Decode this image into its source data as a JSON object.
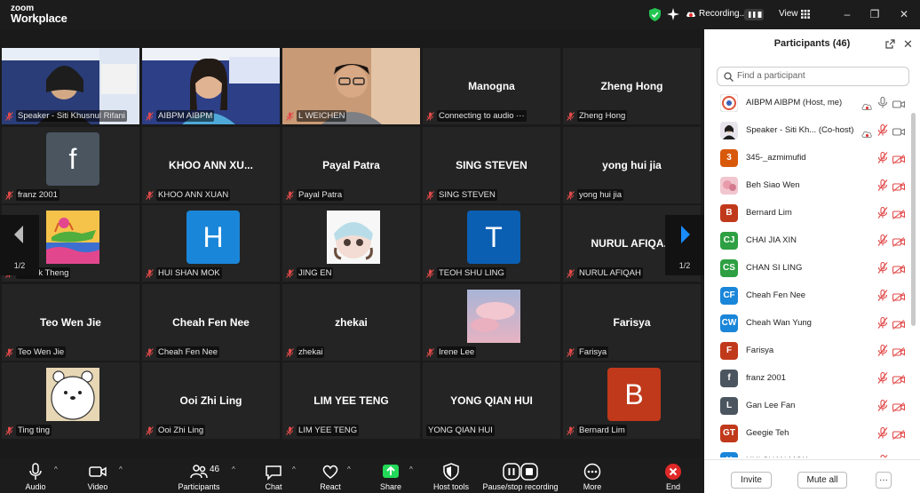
{
  "app": {
    "logo_line1": "zoom",
    "logo_line2": "Workplace"
  },
  "titlebar": {
    "recording_label": "Recording...",
    "view_label": "View",
    "minimize": "–",
    "restore": "❐",
    "close": "✕"
  },
  "gallery": {
    "page_indicator_left": "1/2",
    "page_indicator_right": "1/2",
    "tiles": [
      {
        "label": "Speaker - Siti Khusnul Rifani",
        "type": "video"
      },
      {
        "label": "AIBPM AIBPM",
        "type": "video",
        "active": true
      },
      {
        "label": "L WEICHEN",
        "type": "video"
      },
      {
        "center": "Manogna",
        "label": "Connecting to audio ···"
      },
      {
        "center": "Zheng Hong",
        "label": "Zheng Hong"
      },
      {
        "avatar": "f",
        "avatar_color": "#4a5560",
        "label": "franz 2001"
      },
      {
        "center": "KHOO ANN XU...",
        "label": "KHOO ANN XUAN"
      },
      {
        "center": "Payal Patra",
        "label": "Payal Patra"
      },
      {
        "center": "SING STEVEN",
        "label": "SING STEVEN"
      },
      {
        "center": "yong hui jia",
        "label": "yong hui jia"
      },
      {
        "avatar_pic": "croc",
        "label": "Lai Yik Theng"
      },
      {
        "avatar": "H",
        "avatar_color": "#1a86d9",
        "label": "HUI SHAN MOK"
      },
      {
        "avatar_pic": "chibi",
        "label": "JING EN"
      },
      {
        "avatar": "T",
        "avatar_color": "#0a5fb3",
        "label": "TEOH SHU LING"
      },
      {
        "center": "NURUL AFIQA...",
        "label": "NURUL AFIQAH"
      },
      {
        "center": "Teo Wen Jie",
        "label": "Teo Wen Jie"
      },
      {
        "center": "Cheah Fen Nee",
        "label": "Cheah Fen Nee"
      },
      {
        "center": "zhekai",
        "label": "zhekai"
      },
      {
        "avatar_pic": "sky",
        "label": "Irene Lee"
      },
      {
        "center": "Farisya",
        "label": "Farisya"
      },
      {
        "avatar_pic": "bear",
        "label": "Ting ting"
      },
      {
        "center": "Ooi Zhi Ling",
        "label": "Ooi Zhi Ling"
      },
      {
        "center": "LIM YEE TENG",
        "label": "LIM YEE TENG"
      },
      {
        "center": "YONG QIAN HUI",
        "label": "YONG QIAN HUI",
        "no_mic": true
      },
      {
        "avatar": "B",
        "avatar_color": "#c0391b",
        "label": "Bernard Lim"
      }
    ]
  },
  "toolbar": {
    "audio": "Audio",
    "video": "Video",
    "participants": "Participants",
    "participants_count": "46",
    "chat": "Chat",
    "react": "React",
    "share": "Share",
    "host_tools": "Host tools",
    "pause_recording": "Pause/stop recording",
    "more": "More",
    "end": "End"
  },
  "panel": {
    "title": "Participants (46)",
    "search_placeholder": "Find a participant",
    "invite": "Invite",
    "mute_all": "Mute all",
    "more": "···",
    "participants": [
      {
        "name": "AIBPM AIBPM (Host, me)",
        "avatar_pic": "logo",
        "mic_on": true,
        "cam_on": true,
        "cloud": true
      },
      {
        "name": "Speaker - Siti Kh... (Co-host)",
        "avatar_pic": "person",
        "cloud": true,
        "cam_on": true
      },
      {
        "name": "345-_azmimufid",
        "avatar": "3",
        "color": "#d9590b"
      },
      {
        "name": "Beh Siao Wen",
        "avatar_pic": "pink"
      },
      {
        "name": "Bernard Lim",
        "avatar": "B",
        "color": "#c0391b"
      },
      {
        "name": "CHAI JIA XIN",
        "avatar": "CJ",
        "color": "#2ea043"
      },
      {
        "name": "CHAN SI LING",
        "avatar": "CS",
        "color": "#2ea043"
      },
      {
        "name": "Cheah Fen Nee",
        "avatar": "CF",
        "color": "#1a86d9"
      },
      {
        "name": "Cheah Wan Yung",
        "avatar": "CW",
        "color": "#1a86d9"
      },
      {
        "name": "Farisya",
        "avatar": "F",
        "color": "#c0391b"
      },
      {
        "name": "franz 2001",
        "avatar": "f",
        "color": "#4a5560"
      },
      {
        "name": "Gan Lee Fan",
        "avatar": "L",
        "color": "#4a5560"
      },
      {
        "name": "Geegie Teh",
        "avatar": "GT",
        "color": "#c0391b"
      },
      {
        "name": "HUI SHAN MOK",
        "avatar": "H",
        "color": "#1a86d9"
      }
    ]
  }
}
